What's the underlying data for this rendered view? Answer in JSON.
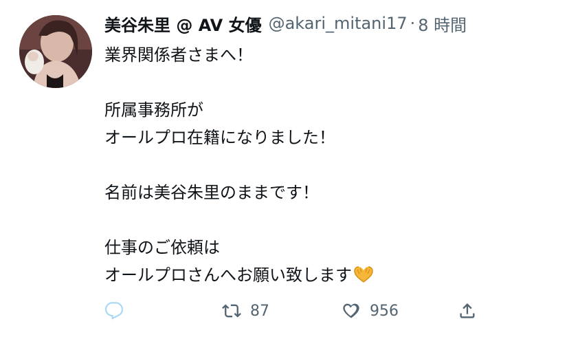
{
  "tweet": {
    "author": {
      "display_name": "美谷朱里 @ AV 女優",
      "handle": "@akari_mitani17",
      "separator": "·",
      "time": "8 時間"
    },
    "body": {
      "l1": "業界関係者さまへ！",
      "l2": "所属事務所が",
      "l3": "オールプロ在籍になりました！",
      "l4": "名前は美谷朱里のままです！",
      "l5": "仕事のご依頼は",
      "l6": "オールプロさんへお願い致します"
    },
    "emoji_icon": "heart-hands-emoji-icon"
  },
  "actions": {
    "reply": {
      "icon": "reply-icon",
      "count": ""
    },
    "retweet": {
      "icon": "retweet-icon",
      "count": "87"
    },
    "like": {
      "icon": "heart-icon",
      "count": "956"
    },
    "share": {
      "icon": "share-icon"
    }
  },
  "colors": {
    "text": "#0f1419",
    "secondary": "#536471",
    "reply_icon": "#a7d8f5",
    "emoji": "#f6b63a"
  }
}
